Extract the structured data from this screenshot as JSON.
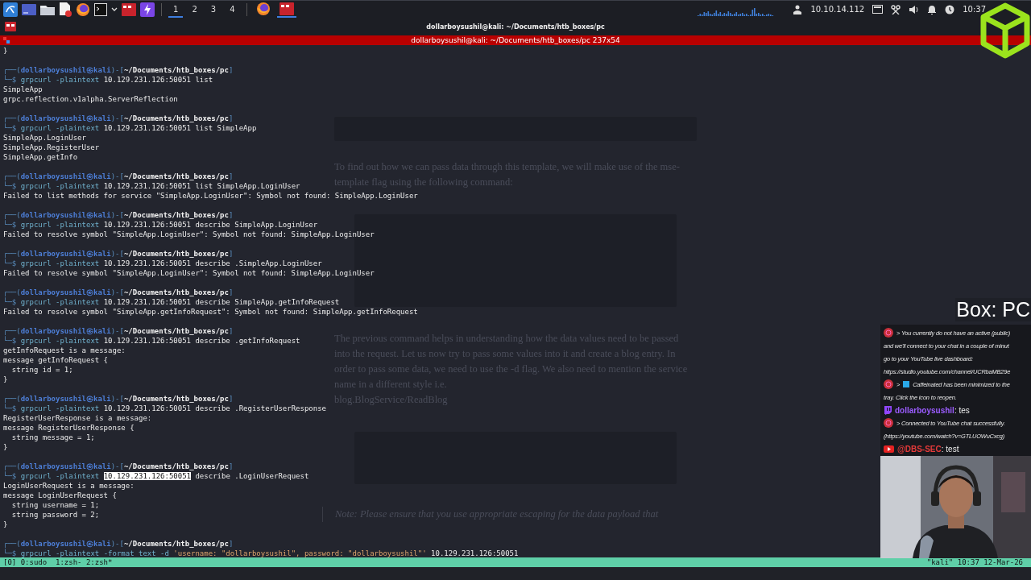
{
  "taskbar": {
    "launchers": [
      {
        "kind": "menu"
      },
      {
        "kind": "desktop"
      },
      {
        "kind": "folder"
      },
      {
        "kind": "editor"
      },
      {
        "kind": "browser"
      },
      {
        "kind": "terminal"
      },
      {
        "kind": "caret"
      },
      {
        "kind": "red-terminal"
      },
      {
        "kind": "bolt"
      }
    ],
    "workspaces": [
      {
        "label": "1",
        "selected": true
      },
      {
        "label": "2",
        "selected": false
      },
      {
        "label": "3",
        "selected": false
      },
      {
        "label": "4",
        "selected": false
      }
    ],
    "tasks": [
      {
        "kind": "browser",
        "active": false
      },
      {
        "kind": "red-terminal",
        "active": true
      }
    ],
    "tray": {
      "ip": "10.10.14.112",
      "time": "10:37"
    }
  },
  "window": {
    "title": "dollarboysushil@kali: ~/Documents/htb_boxes/pc",
    "terminal_title": "dollarboysushil@kali: ~/Documents/htb_boxes/pc 237x54"
  },
  "background_page": {
    "paragraphs": [
      {
        "kind": "text",
        "text": "To find out how we can pass data through this template, we will make use of the mse-template flag using the following command:"
      },
      {
        "kind": "text",
        "text": "The previous command helps in understanding how the data values need to be passed into the request. Let us now try to pass some values into it and create a blog entry. In order to pass some data, we need to use the -d flag. We also need to mention the service name in a different style i.e."
      },
      {
        "kind": "code",
        "text": "blog.BlogService/ReadBlog"
      },
      {
        "kind": "note",
        "text": "Note: Please ensure that you use appropriate escaping for the data payload that"
      }
    ]
  },
  "terminal": {
    "top_lines": [
      "}"
    ],
    "blocks": [
      {
        "prompt": [
          {
            "text": "┌──(",
            "kind": "frame"
          },
          {
            "text": "dollarboysushil㉿kali",
            "kind": "user"
          },
          {
            "text": ")-[",
            "kind": "frame"
          },
          {
            "text": "~/Documents/htb_boxes/pc",
            "kind": "path"
          },
          {
            "text": "]",
            "kind": "frame"
          }
        ],
        "command": [
          {
            "text": "└─$",
            "kind": "frame"
          },
          {
            "text": "grpcurl -plaintext",
            "kind": "keyword"
          },
          {
            "text": "10.129.231.126:50051 list",
            "kind": "plain"
          }
        ],
        "output": [
          "SimpleApp",
          "grpc.reflection.v1alpha.ServerReflection"
        ]
      },
      {
        "prompt": [
          {
            "text": "┌──(",
            "kind": "frame"
          },
          {
            "text": "dollarboysushil㉿kali",
            "kind": "user"
          },
          {
            "text": ")-[",
            "kind": "frame"
          },
          {
            "text": "~/Documents/htb_boxes/pc",
            "kind": "path"
          },
          {
            "text": "]",
            "kind": "frame"
          }
        ],
        "command": [
          {
            "text": "└─$",
            "kind": "frame"
          },
          {
            "text": "grpcurl -plaintext",
            "kind": "keyword"
          },
          {
            "text": "10.129.231.126:50051 list SimpleApp",
            "kind": "plain"
          }
        ],
        "output": [
          "SimpleApp.LoginUser",
          "SimpleApp.RegisterUser",
          "SimpleApp.getInfo"
        ]
      },
      {
        "prompt": [
          {
            "text": "┌──(",
            "kind": "frame"
          },
          {
            "text": "dollarboysushil㉿kali",
            "kind": "user"
          },
          {
            "text": ")-[",
            "kind": "frame"
          },
          {
            "text": "~/Documents/htb_boxes/pc",
            "kind": "path"
          },
          {
            "text": "]",
            "kind": "frame"
          }
        ],
        "command": [
          {
            "text": "└─$",
            "kind": "frame"
          },
          {
            "text": "grpcurl -plaintext",
            "kind": "keyword"
          },
          {
            "text": "10.129.231.126:50051 list SimpleApp.LoginUser",
            "kind": "plain"
          }
        ],
        "output": [
          "Failed to list methods for service \"SimpleApp.LoginUser\": Symbol not found: SimpleApp.LoginUser"
        ]
      },
      {
        "prompt": [
          {
            "text": "┌──(",
            "kind": "frame"
          },
          {
            "text": "dollarboysushil㉿kali",
            "kind": "user"
          },
          {
            "text": ")-[",
            "kind": "frame"
          },
          {
            "text": "~/Documents/htb_boxes/pc",
            "kind": "path"
          },
          {
            "text": "]",
            "kind": "frame"
          }
        ],
        "command": [
          {
            "text": "└─$",
            "kind": "frame"
          },
          {
            "text": "grpcurl -plaintext",
            "kind": "keyword"
          },
          {
            "text": "10.129.231.126:50051 describe SimpleApp.LoginUser",
            "kind": "plain"
          }
        ],
        "output": [
          "Failed to resolve symbol \"SimpleApp.LoginUser\": Symbol not found: SimpleApp.LoginUser"
        ]
      },
      {
        "prompt": [
          {
            "text": "┌──(",
            "kind": "frame"
          },
          {
            "text": "dollarboysushil㉿kali",
            "kind": "user"
          },
          {
            "text": ")-[",
            "kind": "frame"
          },
          {
            "text": "~/Documents/htb_boxes/pc",
            "kind": "path"
          },
          {
            "text": "]",
            "kind": "frame"
          }
        ],
        "command": [
          {
            "text": "└─$",
            "kind": "frame"
          },
          {
            "text": "grpcurl -plaintext",
            "kind": "keyword"
          },
          {
            "text": "10.129.231.126:50051 describe .SimpleApp.LoginUser",
            "kind": "plain"
          }
        ],
        "output": [
          "Failed to resolve symbol \"SimpleApp.LoginUser\": Symbol not found: SimpleApp.LoginUser"
        ]
      },
      {
        "prompt": [
          {
            "text": "┌──(",
            "kind": "frame"
          },
          {
            "text": "dollarboysushil㉿kali",
            "kind": "user"
          },
          {
            "text": ")-[",
            "kind": "frame"
          },
          {
            "text": "~/Documents/htb_boxes/pc",
            "kind": "path"
          },
          {
            "text": "]",
            "kind": "frame"
          }
        ],
        "command": [
          {
            "text": "└─$",
            "kind": "frame"
          },
          {
            "text": "grpcurl -plaintext",
            "kind": "keyword"
          },
          {
            "text": "10.129.231.126:50051 describe SimpleApp.getInfoRequest",
            "kind": "plain"
          }
        ],
        "output": [
          "Failed to resolve symbol \"SimpleApp.getInfoRequest\": Symbol not found: SimpleApp.getInfoRequest"
        ]
      },
      {
        "prompt": [
          {
            "text": "┌──(",
            "kind": "frame"
          },
          {
            "text": "dollarboysushil㉿kali",
            "kind": "user"
          },
          {
            "text": ")-[",
            "kind": "frame"
          },
          {
            "text": "~/Documents/htb_boxes/pc",
            "kind": "path"
          },
          {
            "text": "]",
            "kind": "frame"
          }
        ],
        "command": [
          {
            "text": "└─$",
            "kind": "frame"
          },
          {
            "text": "grpcurl -plaintext",
            "kind": "keyword"
          },
          {
            "text": "10.129.231.126:50051 describe .getInfoRequest",
            "kind": "plain"
          }
        ],
        "output": [
          "getInfoRequest is a message:",
          "message getInfoRequest {",
          "  string id = 1;",
          "}"
        ]
      },
      {
        "prompt": [
          {
            "text": "┌──(",
            "kind": "frame"
          },
          {
            "text": "dollarboysushil㉿kali",
            "kind": "user"
          },
          {
            "text": ")-[",
            "kind": "frame"
          },
          {
            "text": "~/Documents/htb_boxes/pc",
            "kind": "path"
          },
          {
            "text": "]",
            "kind": "frame"
          }
        ],
        "command": [
          {
            "text": "└─$",
            "kind": "frame"
          },
          {
            "text": "grpcurl -plaintext",
            "kind": "keyword"
          },
          {
            "text": "10.129.231.126:50051 describe .RegisterUserResponse",
            "kind": "plain"
          }
        ],
        "output": [
          "RegisterUserResponse is a message:",
          "message RegisterUserResponse {",
          "  string message = 1;",
          "}"
        ]
      },
      {
        "prompt": [
          {
            "text": "┌──(",
            "kind": "frame"
          },
          {
            "text": "dollarboysushil㉿kali",
            "kind": "user"
          },
          {
            "text": ")-[",
            "kind": "frame"
          },
          {
            "text": "~/Documents/htb_boxes/pc",
            "kind": "path"
          },
          {
            "text": "]",
            "kind": "frame"
          }
        ],
        "command": [
          {
            "text": "└─$",
            "kind": "frame"
          },
          {
            "text": "grpcurl -plaintext",
            "kind": "keyword"
          },
          {
            "text": "10.129.231.126:50051",
            "kind": "selected"
          },
          {
            "text": "describe .LoginUserRequest",
            "kind": "plain"
          }
        ],
        "output": [
          "LoginUserRequest is a message:",
          "message LoginUserRequest {",
          "  string username = 1;",
          "  string password = 2;",
          "}"
        ]
      },
      {
        "prompt": [
          {
            "text": "┌──(",
            "kind": "frame"
          },
          {
            "text": "dollarboysushil㉿kali",
            "kind": "user"
          },
          {
            "text": ")-[",
            "kind": "frame"
          },
          {
            "text": "~/Documents/htb_boxes/pc",
            "kind": "path"
          },
          {
            "text": "]",
            "kind": "frame"
          }
        ],
        "command": [
          {
            "text": "└─$",
            "kind": "frame"
          },
          {
            "text": "grpcurl -plaintext -format text -d",
            "kind": "keyword"
          },
          {
            "text": "'username: \"dollarboysushil\", password: \"dollarboysushil\"'",
            "kind": "string"
          },
          {
            "text": "10.129.231.126:50051",
            "kind": "plain"
          }
        ]
      }
    ]
  },
  "status_bar": {
    "windows": "[0] 0:sudo  1:zsh- 2:zsh*",
    "right": "\"kali\" 10:37 12-Mar-26"
  },
  "overlay": {
    "box_label": "Box: PC",
    "chat": [
      {
        "kind": "system",
        "lines": [
          "> You currently do not have an active (public)",
          "and we'll connect to your chat in a couple of minut",
          "go to your YouTube live dashboard:",
          "https://studio.youtube.com/channel/UCRbaMB29e"
        ]
      },
      {
        "kind": "system-app",
        "prefix": ">",
        "lines": [
          "Caffeinated has been minimized to the",
          "tray. Click the icon to reopen."
        ]
      },
      {
        "kind": "twitch",
        "user": "dollarboysushil",
        "text": ": tes"
      },
      {
        "kind": "system",
        "lines": [
          "> Connected to YouTube chat successfully.",
          "(https://youtube.com/watch?v=GTLUOWuCxcg)"
        ]
      },
      {
        "kind": "youtube",
        "user": "@DBS-SEC",
        "text": ": test"
      }
    ]
  }
}
